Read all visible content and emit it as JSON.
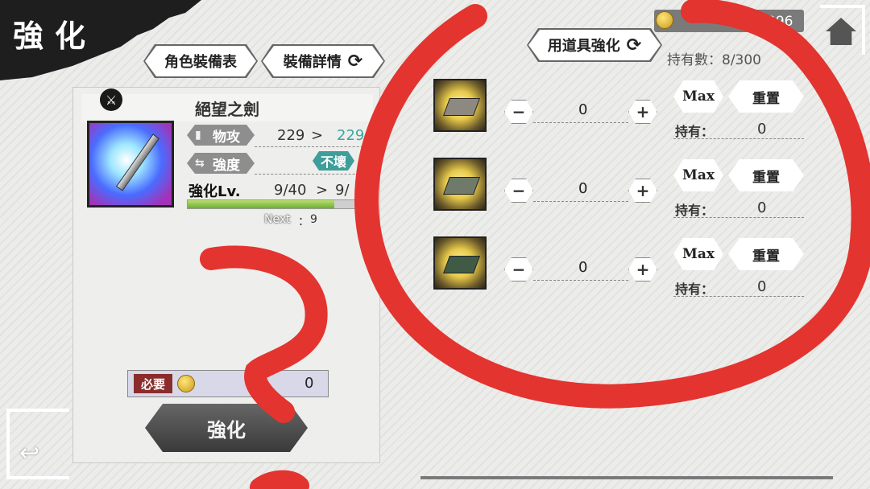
{
  "header": {
    "screen_title": "強化",
    "tabs": [
      "角色裝備表",
      "裝備詳情"
    ],
    "tool_tab": "用道具強化",
    "coins": "396",
    "owned_count": "持有數：8/300"
  },
  "item": {
    "name": "絕望之劍",
    "stats": [
      {
        "label": "物攻",
        "current": "229",
        "arrow": ">",
        "next": "229"
      },
      {
        "label": "強度",
        "value": "不壞"
      }
    ],
    "level_label": "強化Lv.",
    "level_current": "9/40",
    "level_arrow": ">",
    "level_next": "9/",
    "xp_fraction": 0.8,
    "next_label": "Next",
    "next_sep": "：",
    "next_value": "9"
  },
  "cost": {
    "tag": "必要",
    "value": "0"
  },
  "enhance_button": "強化",
  "materials": [
    {
      "qty": "0",
      "max_label": "Max",
      "reset_label": "重置",
      "own_label": "持有：",
      "own_value": "0",
      "color": "#8d8880"
    },
    {
      "qty": "0",
      "max_label": "Max",
      "reset_label": "重置",
      "own_label": "持有：",
      "own_value": "0",
      "color": "#6f7a6a"
    },
    {
      "qty": "0",
      "max_label": "Max",
      "reset_label": "重置",
      "own_label": "持有：",
      "own_value": "0",
      "color": "#3f5a45"
    }
  ],
  "icons": {
    "minus": "−",
    "plus": "+",
    "refresh": "⟳",
    "back": "↩",
    "sword_badge": "⚔"
  },
  "colors": {
    "annotation_red": "#e3342f",
    "teal": "#3aa6a0",
    "dark": "#1a1a1a"
  }
}
